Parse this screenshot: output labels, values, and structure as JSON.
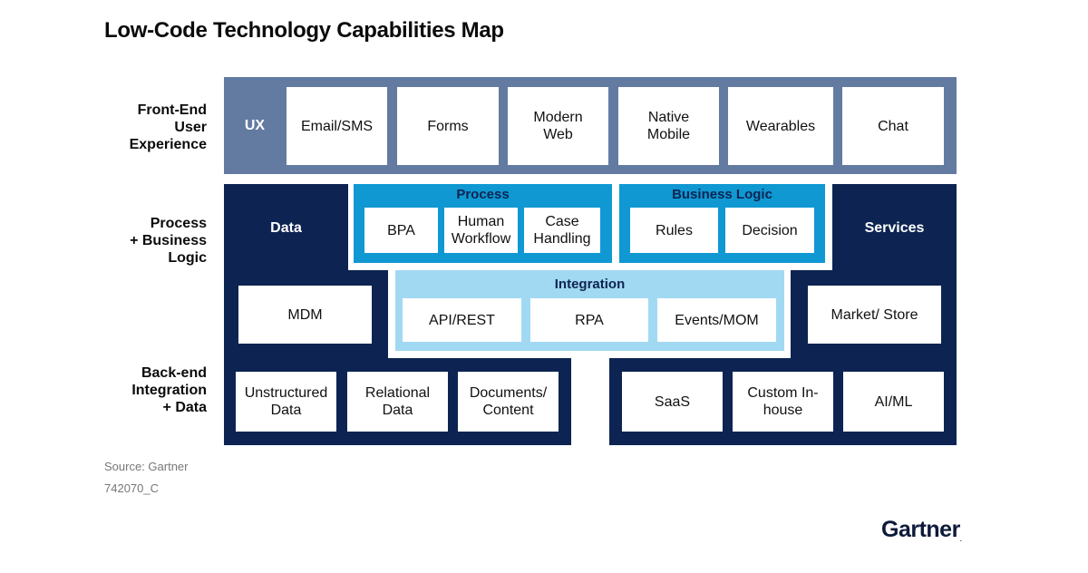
{
  "title": "Low-Code Technology Capabilities Map",
  "row_labels": {
    "front_end": "Front-End\nUser\nExperience",
    "process": "Process\n+ Business\nLogic",
    "back_end": "Back-end\nIntegration\n+ Data"
  },
  "ux": {
    "label": "UX",
    "items": [
      "Email/SMS",
      "Forms",
      "Modern\nWeb",
      "Native\nMobile",
      "Wearables",
      "Chat"
    ]
  },
  "data_group": {
    "label": "Data",
    "mdm": "MDM",
    "items": [
      "Unstructured\nData",
      "Relational\nData",
      "Documents/\nContent"
    ]
  },
  "process_group": {
    "label": "Process",
    "items": [
      "BPA",
      "Human\nWorkflow",
      "Case\nHandling"
    ]
  },
  "business_logic_group": {
    "label": "Business Logic",
    "items": [
      "Rules",
      "Decision"
    ]
  },
  "integration_group": {
    "label": "Integration",
    "items": [
      "API/REST",
      "RPA",
      "Events/MOM"
    ]
  },
  "services_group": {
    "label": "Services",
    "market": "Market/ Store",
    "items": [
      "SaaS",
      "Custom In-\nhouse",
      "AI/ML"
    ]
  },
  "footer": {
    "source": "Source: Gartner",
    "code": "742070_C",
    "logo": "Gartner",
    "logo_mark": "."
  },
  "colors": {
    "ux_band": "#637ba1",
    "dark_navy": "#0d2452",
    "process_blue": "#0f98d2",
    "integration_light_blue": "#a2d9f2"
  }
}
